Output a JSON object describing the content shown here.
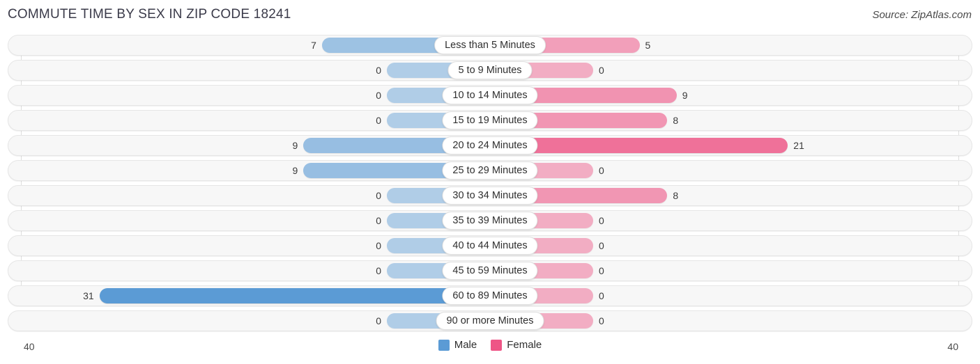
{
  "header": {
    "title": "COMMUTE TIME BY SEX IN ZIP CODE 18241",
    "source": "Source: ZipAtlas.com"
  },
  "axis": {
    "left_label": "40",
    "right_label": "40",
    "max": 40
  },
  "legend": {
    "items": [
      {
        "label": "Male",
        "color": "#5b9bd5"
      },
      {
        "label": "Female",
        "color": "#ee5586"
      }
    ]
  },
  "chart_data": {
    "type": "bar",
    "orientation": "horizontal-diverging",
    "title": "COMMUTE TIME BY SEX IN ZIP CODE 18241",
    "xlabel": "",
    "ylabel": "",
    "xlim": [
      40,
      40
    ],
    "grid": true,
    "legend_position": "bottom-center",
    "categories": [
      "Less than 5 Minutes",
      "5 to 9 Minutes",
      "10 to 14 Minutes",
      "15 to 19 Minutes",
      "20 to 24 Minutes",
      "25 to 29 Minutes",
      "30 to 34 Minutes",
      "35 to 39 Minutes",
      "40 to 44 Minutes",
      "45 to 59 Minutes",
      "60 to 89 Minutes",
      "90 or more Minutes"
    ],
    "series": [
      {
        "name": "Male",
        "color": "#5b9bd5",
        "side": "left",
        "values": [
          7,
          0,
          0,
          0,
          9,
          9,
          0,
          0,
          0,
          0,
          31,
          0
        ]
      },
      {
        "name": "Female",
        "color": "#ee5586",
        "side": "right",
        "values": [
          5,
          0,
          9,
          8,
          21,
          0,
          8,
          0,
          0,
          0,
          0,
          0
        ]
      }
    ]
  }
}
